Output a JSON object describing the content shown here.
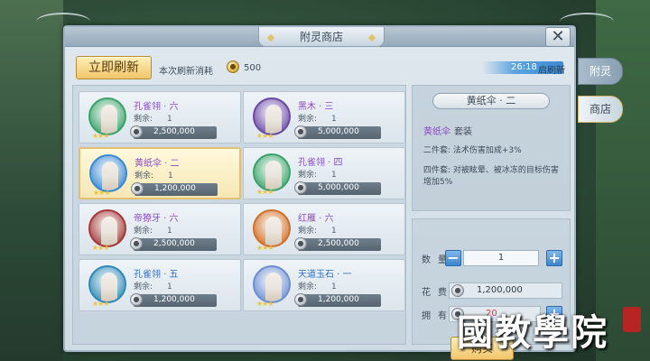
{
  "window": {
    "title": "附灵商店",
    "close_label": "✕"
  },
  "toolbar": {
    "refresh_label": "立即刷新",
    "cost_label": "本次刷新消耗",
    "cost_coin_icon": "gold-coin-icon",
    "cost_value": "500",
    "timer_value": "26:18",
    "timer_label": "启刷新"
  },
  "items": [
    {
      "name": "孔雀翎 · 六",
      "color": "#8a4bc2",
      "stock_label": "剩余:",
      "stock": "1",
      "price": "2,500,000",
      "selected": false,
      "ring": "#3aa36b"
    },
    {
      "name": "黑木 · 三",
      "color": "#8a4bc2",
      "stock_label": "剩余:",
      "stock": "1",
      "price": "5,000,000",
      "selected": false,
      "ring": "#6b4aa6"
    },
    {
      "name": "黄纸伞 · 二",
      "color": "#8a4bc2",
      "stock_label": "剩余:",
      "stock": "1",
      "price": "1,200,000",
      "selected": true,
      "ring": "#3a8ad3"
    },
    {
      "name": "孔雀翎 · 四",
      "color": "#8a4bc2",
      "stock_label": "剩余:",
      "stock": "1",
      "price": "5,000,000",
      "selected": false,
      "ring": "#3aa36b"
    },
    {
      "name": "帝獠牙 · 六",
      "color": "#8a4bc2",
      "stock_label": "剩余:",
      "stock": "1",
      "price": "2,500,000",
      "selected": false,
      "ring": "#a63a3a"
    },
    {
      "name": "红雁 · 六",
      "color": "#8a4bc2",
      "stock_label": "剩余:",
      "stock": "1",
      "price": "2,500,000",
      "selected": false,
      "ring": "#d0702a"
    },
    {
      "name": "孔雀翎 · 五",
      "color": "#2f6fc4",
      "stock_label": "剩余:",
      "stock": "1",
      "price": "1,200,000",
      "selected": false,
      "ring": "#2f8ab8"
    },
    {
      "name": "天道玉石 · 一",
      "color": "#2f6fc4",
      "stock_label": "剩余:",
      "stock": "1",
      "price": "1,200,000",
      "selected": false,
      "ring": "#6d8fd0"
    }
  ],
  "detail": {
    "title": "黄纸伞 · 二",
    "set_name": "黄纸伞",
    "set_suffix": "套装",
    "two_piece": "二件套: 法术伤害加成+3%",
    "four_piece": "四件套: 对被眩晕、被冰冻的目标伤害增加5%",
    "qty_label": "数量",
    "qty_value": "1",
    "cost_label": "花费",
    "cost_value": "1,200,000",
    "own_label": "拥有",
    "own_value": "20",
    "buy_label": "购买"
  },
  "side_tabs": [
    {
      "label": "附灵",
      "active": false
    },
    {
      "label": "商店",
      "active": true
    }
  ],
  "watermark": "國教學院"
}
